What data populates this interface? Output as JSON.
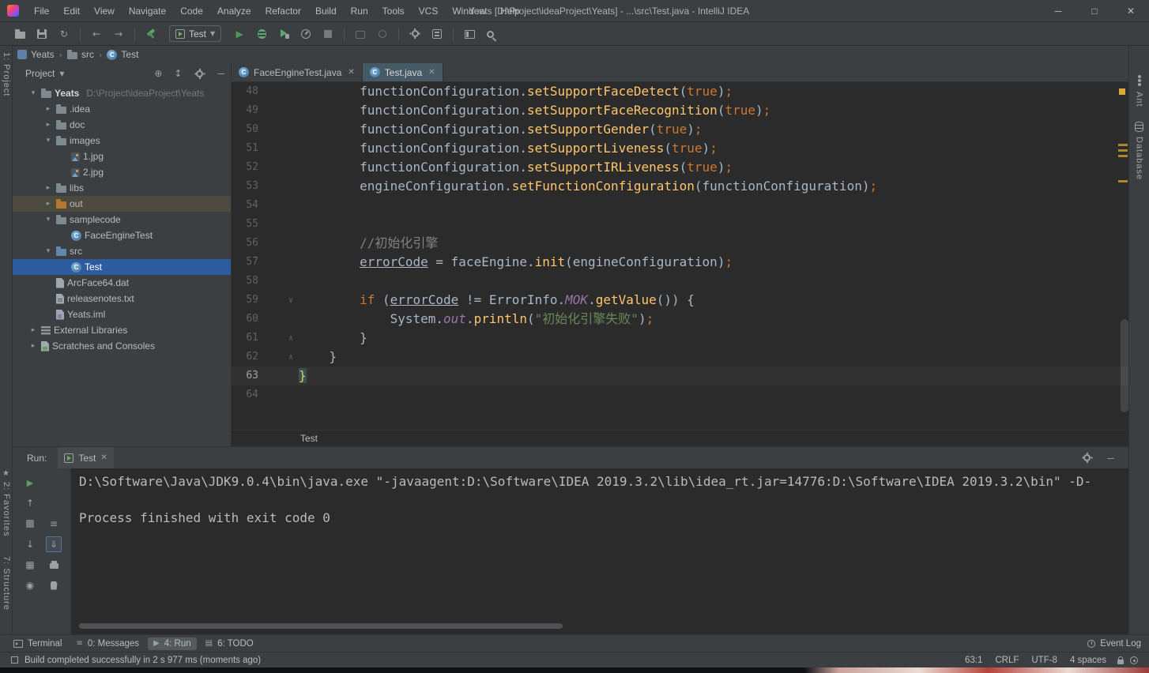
{
  "titlebar": {
    "title": "Yeats [D:\\Project\\ideaProject\\Yeats] - ...\\src\\Test.java - IntelliJ IDEA",
    "menus": [
      "File",
      "Edit",
      "View",
      "Navigate",
      "Code",
      "Analyze",
      "Refactor",
      "Build",
      "Run",
      "Tools",
      "VCS",
      "Window",
      "Help"
    ]
  },
  "toolbar": {
    "run_config": "Test"
  },
  "navbar": {
    "items": [
      {
        "label": "Yeats",
        "icon": "module"
      },
      {
        "label": "src",
        "icon": "folder"
      },
      {
        "label": "Test",
        "icon": "class"
      }
    ]
  },
  "left_stripe": {
    "project": "1: Project",
    "favorites": "2: Favorites",
    "structure": "7: Structure"
  },
  "right_stripe": {
    "items": [
      {
        "label": "Ant",
        "icon": "ant"
      },
      {
        "label": "Database",
        "icon": "db"
      }
    ]
  },
  "project": {
    "header": "Project",
    "tree": [
      {
        "label": "Yeats",
        "hint": "D:\\Project\\ideaProject\\Yeats",
        "level": 0,
        "chev": "down",
        "icon": "folder",
        "bold": true
      },
      {
        "label": ".idea",
        "level": 1,
        "chev": "right",
        "icon": "folder"
      },
      {
        "label": "doc",
        "level": 1,
        "chev": "right",
        "icon": "folder"
      },
      {
        "label": "images",
        "level": 1,
        "chev": "down",
        "icon": "folder"
      },
      {
        "label": "1.jpg",
        "level": 2,
        "icon": "image"
      },
      {
        "label": "2.jpg",
        "level": 2,
        "icon": "image"
      },
      {
        "label": "libs",
        "level": 1,
        "chev": "right",
        "icon": "folder"
      },
      {
        "label": "out",
        "level": 1,
        "chev": "right",
        "icon": "folder-ex",
        "row": "hov"
      },
      {
        "label": "samplecode",
        "level": 1,
        "chev": "down",
        "icon": "folder"
      },
      {
        "label": "FaceEngineTest",
        "level": 2,
        "icon": "class"
      },
      {
        "label": "src",
        "level": 1,
        "chev": "down",
        "icon": "folder-src"
      },
      {
        "label": "Test",
        "level": 2,
        "icon": "class",
        "row": "sel"
      },
      {
        "label": "ArcFace64.dat",
        "level": 1,
        "icon": "page"
      },
      {
        "label": "releasenotes.txt",
        "level": 1,
        "icon": "text"
      },
      {
        "label": "Yeats.iml",
        "level": 1,
        "icon": "iml"
      },
      {
        "label": "External Libraries",
        "level": 0,
        "chev": "right",
        "icon": "lib"
      },
      {
        "label": "Scratches and Consoles",
        "level": 0,
        "chev": "right",
        "icon": "scratch"
      }
    ]
  },
  "editor": {
    "tabs": [
      {
        "label": "FaceEngineTest.java",
        "active": false
      },
      {
        "label": "Test.java",
        "active": true
      }
    ],
    "crumb": "Test",
    "lines": [
      {
        "n": 48,
        "t": [
          [
            "pln",
            "        functionConfiguration."
          ],
          [
            "mth",
            "setSupportFaceDetect"
          ],
          [
            "pln",
            "("
          ],
          [
            "kw",
            "true"
          ],
          [
            "pln",
            ")"
          ],
          [
            "sem",
            ";"
          ]
        ]
      },
      {
        "n": 49,
        "t": [
          [
            "pln",
            "        functionConfiguration."
          ],
          [
            "mth",
            "setSupportFaceRecognition"
          ],
          [
            "pln",
            "("
          ],
          [
            "kw",
            "true"
          ],
          [
            "pln",
            ")"
          ],
          [
            "sem",
            ";"
          ]
        ]
      },
      {
        "n": 50,
        "t": [
          [
            "pln",
            "        functionConfiguration."
          ],
          [
            "mth",
            "setSupportGender"
          ],
          [
            "pln",
            "("
          ],
          [
            "kw",
            "true"
          ],
          [
            "pln",
            ")"
          ],
          [
            "sem",
            ";"
          ]
        ]
      },
      {
        "n": 51,
        "t": [
          [
            "pln",
            "        functionConfiguration."
          ],
          [
            "mth",
            "setSupportLiveness"
          ],
          [
            "pln",
            "("
          ],
          [
            "kw",
            "true"
          ],
          [
            "pln",
            ")"
          ],
          [
            "sem",
            ";"
          ]
        ]
      },
      {
        "n": 52,
        "t": [
          [
            "pln",
            "        functionConfiguration."
          ],
          [
            "mth",
            "setSupportIRLiveness"
          ],
          [
            "pln",
            "("
          ],
          [
            "kw",
            "true"
          ],
          [
            "pln",
            ")"
          ],
          [
            "sem",
            ";"
          ]
        ]
      },
      {
        "n": 53,
        "t": [
          [
            "pln",
            "        engineConfiguration."
          ],
          [
            "mth",
            "setFunctionConfiguration"
          ],
          [
            "pln",
            "(functionConfiguration)"
          ],
          [
            "sem",
            ";"
          ]
        ]
      },
      {
        "n": 54,
        "t": []
      },
      {
        "n": 55,
        "t": []
      },
      {
        "n": 56,
        "t": [
          [
            "pln",
            "        "
          ],
          [
            "cmt",
            "//初始化引擎"
          ]
        ]
      },
      {
        "n": 57,
        "t": [
          [
            "pln",
            "        "
          ],
          [
            "und",
            "errorCode"
          ],
          [
            "pln",
            " = faceEngine."
          ],
          [
            "mth",
            "init"
          ],
          [
            "pln",
            "(engineConfiguration)"
          ],
          [
            "sem",
            ";"
          ]
        ]
      },
      {
        "n": 58,
        "t": []
      },
      {
        "n": 59,
        "fold": "v",
        "t": [
          [
            "pln",
            "        "
          ],
          [
            "kw",
            "if"
          ],
          [
            "pln",
            " ("
          ],
          [
            "und",
            "errorCode"
          ],
          [
            "pln",
            " != ErrorInfo."
          ],
          [
            "fld",
            "MOK"
          ],
          [
            "pln",
            "."
          ],
          [
            "mth",
            "getValue"
          ],
          [
            "pln",
            "()) {"
          ]
        ]
      },
      {
        "n": 60,
        "t": [
          [
            "pln",
            "            System."
          ],
          [
            "fld",
            "out"
          ],
          [
            "pln",
            "."
          ],
          [
            "mth",
            "println"
          ],
          [
            "pln",
            "("
          ],
          [
            "str",
            "\"初始化引擎失败\""
          ],
          [
            "pln",
            ")"
          ],
          [
            "sem",
            ";"
          ]
        ]
      },
      {
        "n": 61,
        "fold": "u",
        "t": [
          [
            "pln",
            "        }"
          ]
        ]
      },
      {
        "n": 62,
        "fold": "u",
        "t": [
          [
            "pln",
            "    }"
          ]
        ]
      },
      {
        "n": 63,
        "cur": true,
        "caret": true,
        "t": [
          [
            "mbr",
            "}"
          ]
        ]
      },
      {
        "n": 64,
        "t": []
      }
    ]
  },
  "run": {
    "label": "Run:",
    "tab": "Test",
    "console_lines": [
      "D:\\Software\\Java\\JDK9.0.4\\bin\\java.exe \"-javaagent:D:\\Software\\IDEA 2019.3.2\\lib\\idea_rt.jar=14776:D:\\Software\\IDEA 2019.3.2\\bin\" -D-",
      "",
      "Process finished with exit code 0"
    ]
  },
  "bottom_bar": {
    "items": [
      {
        "label": "Terminal",
        "icon": "terminal",
        "active": false
      },
      {
        "label": "0: Messages",
        "icon": "messages",
        "active": false
      },
      {
        "label": "4: Run",
        "icon": "run",
        "active": true
      },
      {
        "label": "6: TODO",
        "icon": "todo",
        "active": false
      }
    ],
    "event_log": "Event Log"
  },
  "status_bar": {
    "message": "Build completed successfully in 2 s 977 ms (moments ago)",
    "items": [
      "63:1",
      "CRLF",
      "UTF-8",
      "4 spaces"
    ]
  },
  "colors": {
    "selection_blue": "#2D5C9E",
    "accent_green": "#499C54",
    "warning_yellow": "#D9A93F",
    "editor_bg": "#2B2B2B",
    "panel_bg": "#3C3F41"
  }
}
